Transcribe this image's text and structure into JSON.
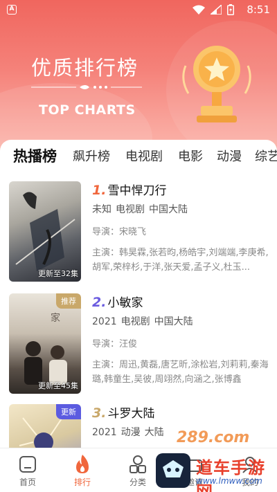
{
  "status_bar": {
    "time": "8:51",
    "app_badge": "A"
  },
  "hero": {
    "title": "优质排行榜",
    "subtitle": "TOP CHARTS"
  },
  "tabs": [
    {
      "label": "热播榜",
      "active": true
    },
    {
      "label": "飙升榜",
      "active": false
    },
    {
      "label": "电视剧",
      "active": false
    },
    {
      "label": "电影",
      "active": false
    },
    {
      "label": "动漫",
      "active": false
    },
    {
      "label": "综艺",
      "active": false
    }
  ],
  "items": [
    {
      "rank": "1.",
      "rank_color": "#f0663c",
      "title": "雪中悍刀行",
      "year": "未知",
      "type": "电视剧",
      "region": "中国大陆",
      "director": "导演：宋晓飞",
      "cast": "主演：韩昊霖,张若昀,杨皓宇,刘端端,李庚希,胡军,荣梓杉,于洋,张天爱,孟子义,杜玉...",
      "episode": "更新至32集",
      "tag": ""
    },
    {
      "rank": "2.",
      "rank_color": "#6b5ce0",
      "title": "小敏家",
      "year": "2021",
      "type": "电视剧",
      "region": "中国大陆",
      "director": "导演：汪俊",
      "cast": "主演：周迅,黄磊,唐艺昕,涂松岩,刘莉莉,秦海璐,韩童生,吴彼,周翊然,向涵之,张博鑫",
      "episode": "更新至45集",
      "tag": "推荐",
      "tag_color": "#c9a86a"
    },
    {
      "rank": "3.",
      "rank_color": "#c9a86a",
      "title": "斗罗大陆",
      "year": "2021",
      "type": "动漫",
      "region": "大陆",
      "director": "",
      "cast": "",
      "episode": "",
      "tag": "更新",
      "tag_color": "#5b5be0"
    }
  ],
  "nav": [
    {
      "label": "首页",
      "active": false
    },
    {
      "label": "排行",
      "active": true
    },
    {
      "label": "分类",
      "active": false
    },
    {
      "label": "邀请",
      "active": false
    },
    {
      "label": "我的",
      "active": false
    }
  ],
  "watermark": {
    "line1": "289.com",
    "line2": "道车手游网",
    "line3": "www.lmww.com"
  }
}
